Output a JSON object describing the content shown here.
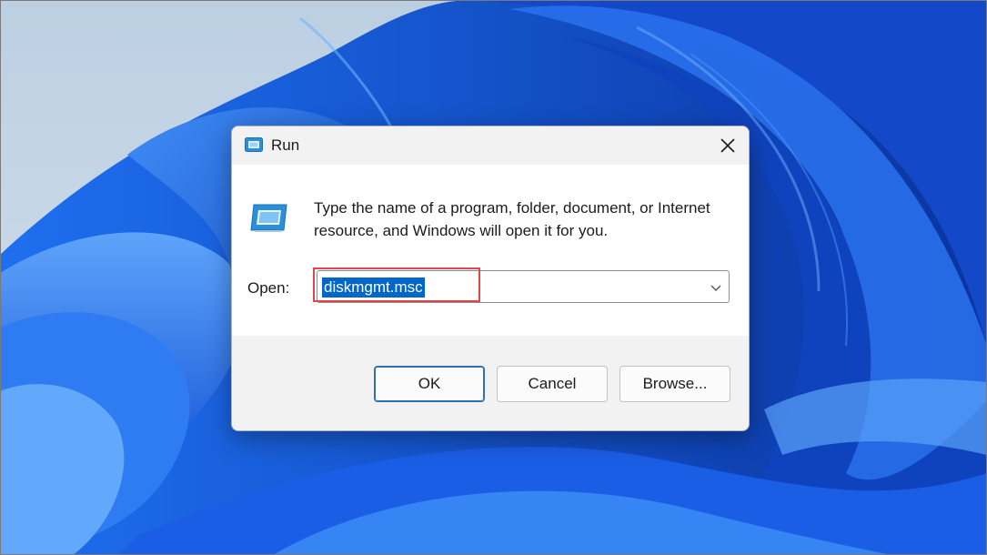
{
  "dialog": {
    "title": "Run",
    "description": "Type the name of a program, folder, document, or Internet resource, and Windows will open it for you.",
    "open_label": "Open:",
    "open_value": "diskmgmt.msc",
    "ok_label": "OK",
    "cancel_label": "Cancel",
    "browse_label": "Browse..."
  },
  "icons": [
    "run-icon",
    "close-icon",
    "chevron-down-icon"
  ],
  "colors": {
    "selection": "#0066cc",
    "highlight_box": "#e0454a",
    "wallpaper_blue": "#1d5fe0",
    "wallpaper_sky": "#c9d9e8"
  }
}
